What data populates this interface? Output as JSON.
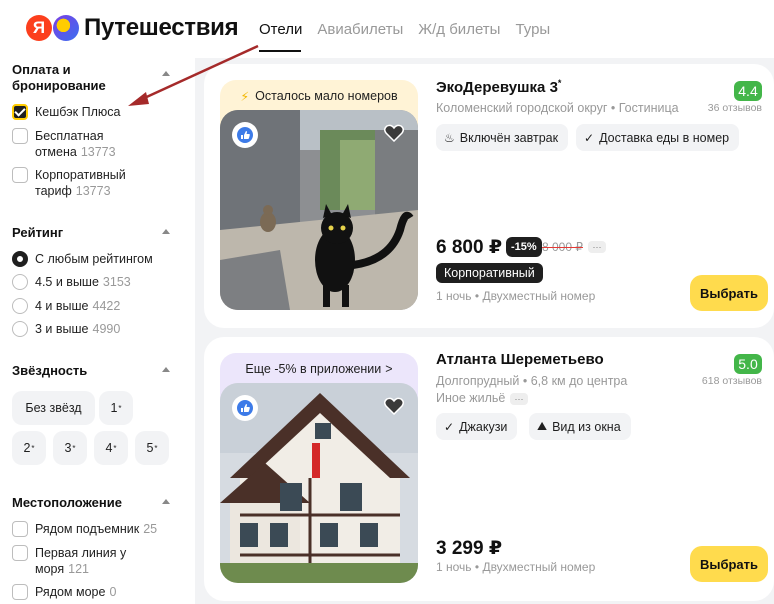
{
  "header": {
    "logo_letter": "Я",
    "logo_text": "Путешествия",
    "nav": [
      {
        "label": "Отели",
        "active": true
      },
      {
        "label": "Авиабилеты",
        "active": false
      },
      {
        "label": "Ж/д билеты",
        "active": false
      },
      {
        "label": "Туры",
        "active": false
      }
    ]
  },
  "filters": {
    "payment": {
      "title_line1": "Оплата и",
      "title_line2": "бронирование",
      "options": [
        {
          "label": "Кешбэк Плюса",
          "count": "",
          "checked": true
        },
        {
          "label_line1": "Бесплатная",
          "label_line2": "отмена",
          "count": "13773",
          "checked": false
        },
        {
          "label_line1": "Корпоративный",
          "label_line2": "тариф",
          "count": "13773",
          "checked": false
        }
      ]
    },
    "rating": {
      "title": "Рейтинг",
      "options": [
        {
          "label": "С любым рейтингом",
          "count": "",
          "checked": true
        },
        {
          "label": "4.5 и выше",
          "count": "3153",
          "checked": false
        },
        {
          "label": "4 и выше",
          "count": "4422",
          "checked": false
        },
        {
          "label": "3 и выше",
          "count": "4990",
          "checked": false
        }
      ]
    },
    "stars": {
      "title": "Звёздность",
      "no_stars": "Без звёзд",
      "values": [
        "1",
        "2",
        "3",
        "4",
        "5"
      ],
      "star_mark": "*"
    },
    "location": {
      "title": "Местоположение",
      "options": [
        {
          "label": "Рядом подъемник",
          "count": "25",
          "checked": false
        },
        {
          "label_line1": "Первая линия у",
          "label_line2": "моря",
          "count": "121",
          "checked": false
        },
        {
          "label": "Рядом море",
          "count": "0",
          "checked": false
        }
      ]
    }
  },
  "hotels": [
    {
      "badge": "Осталось мало номеров",
      "badge_icon": "lightning-icon",
      "name": "ЭкоДеревушка 3",
      "star_mark": "*",
      "location": "Коломенский городской округ",
      "type": "Гостиница",
      "rating": "4.4",
      "reviews": "36 отзывов",
      "amenities": [
        {
          "icon": "breakfast-icon",
          "glyph": "♨",
          "label": "Включён завтрак"
        },
        {
          "icon": "check-icon",
          "glyph": "✓",
          "label": "Доставка еды в номер"
        }
      ],
      "price": "6 800 ₽",
      "discount": "-15%",
      "old_price": "8 000 ₽",
      "more": "···",
      "corporate": "Корпоративный",
      "nights": "1 ночь",
      "room": "Двухместный номер",
      "select_label": "Выбрать"
    },
    {
      "badge": "Еще -5% в приложении",
      "badge_icon": "chevron-right-icon",
      "name": "Атланта Шереметьево",
      "location": "Долгопрудный",
      "distance": "6,8 км до центра",
      "type": "Иное жильё",
      "more": "···",
      "rating": "5.0",
      "reviews": "618 отзывов",
      "amenities": [
        {
          "icon": "check-icon",
          "glyph": "✓",
          "label": "Джакузи"
        },
        {
          "icon": "window-view-icon",
          "glyph": "⛰",
          "label": "Вид из окна"
        }
      ],
      "price": "3 299 ₽",
      "nights": "1 ночь",
      "room": "Двухместный номер",
      "select_label": "Выбрать"
    }
  ],
  "colors": {
    "accent_yellow": "#ffdb4d",
    "rating_green": "#43b649",
    "annotation_arrow": "#a52a2a",
    "badge_peach": "#fff3d6",
    "badge_lavender": "#ece6fb"
  }
}
